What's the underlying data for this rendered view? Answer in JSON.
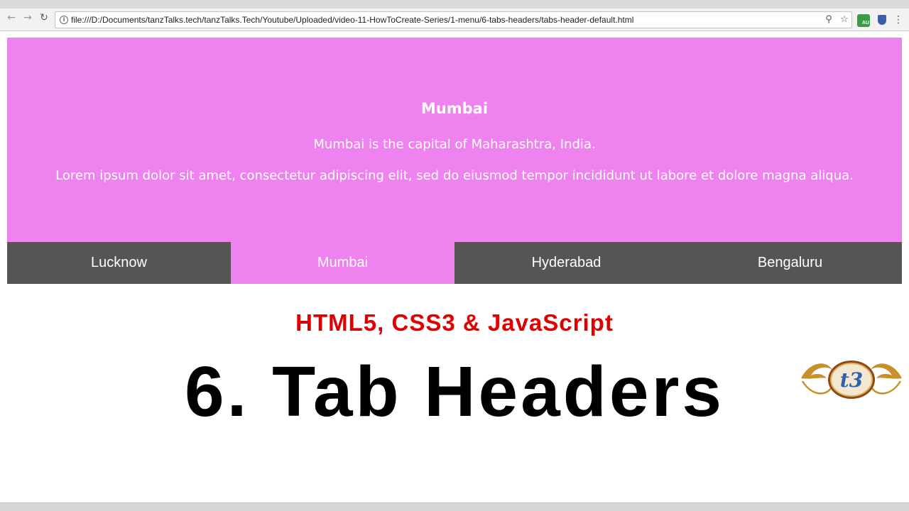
{
  "browser": {
    "url": "file:///D:/Documents/tanzTalks.tech/tanzTalks.Tech/Youtube/Uploaded/video-11-HowToCreate-Series/1-menu/6-tabs-headers/tabs-header-default.html",
    "extension_badge": "AU"
  },
  "panel": {
    "title": "Mumbai",
    "line1": "Mumbai is the capital of Maharashtra, India.",
    "line2": "Lorem ipsum dolor sit amet, consectetur adipiscing elit, sed do eiusmod tempor incididunt ut labore et dolore magna aliqua.",
    "color": "#ee82ee"
  },
  "tabs": [
    {
      "label": "Lucknow",
      "active": false
    },
    {
      "label": "Mumbai",
      "active": true
    },
    {
      "label": "Hyderabad",
      "active": false
    },
    {
      "label": "Bengaluru",
      "active": false
    }
  ],
  "tab_inactive_color": "#555555",
  "overlay": {
    "subtitle": "HTML5, CSS3 & JavaScript",
    "headline": "6. Tab Headers",
    "logo_text": "t3"
  }
}
